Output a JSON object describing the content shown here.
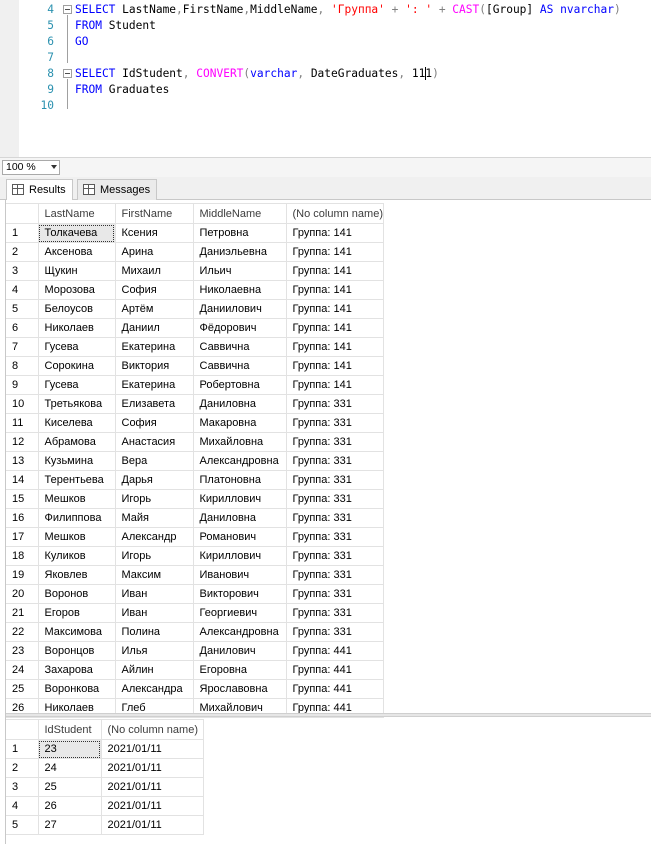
{
  "editor": {
    "lines": [
      {
        "number": "4",
        "tokens": [
          {
            "t": "SELECT",
            "c": "kw"
          },
          {
            "t": " LastName",
            "c": "id"
          },
          {
            "t": ",",
            "c": "op"
          },
          {
            "t": "FirstName",
            "c": "id"
          },
          {
            "t": ",",
            "c": "op"
          },
          {
            "t": "MiddleName",
            "c": "id"
          },
          {
            "t": ", ",
            "c": "op"
          },
          {
            "t": "'Группа'",
            "c": "str"
          },
          {
            "t": " + ",
            "c": "op"
          },
          {
            "t": "': '",
            "c": "str"
          },
          {
            "t": " + ",
            "c": "op"
          },
          {
            "t": "CAST",
            "c": "fn"
          },
          {
            "t": "(",
            "c": "op"
          },
          {
            "t": "[Group]",
            "c": "id"
          },
          {
            "t": " AS ",
            "c": "kw"
          },
          {
            "t": "nvarchar",
            "c": "ty"
          },
          {
            "t": ")",
            "c": "op"
          }
        ]
      },
      {
        "number": "5",
        "tokens": [
          {
            "t": "FROM",
            "c": "kw"
          },
          {
            "t": " Student",
            "c": "id"
          }
        ]
      },
      {
        "number": "6",
        "tokens": [
          {
            "t": "GO",
            "c": "kw"
          }
        ]
      },
      {
        "number": "7",
        "tokens": []
      },
      {
        "number": "8",
        "tokens": [
          {
            "t": "SELECT",
            "c": "kw"
          },
          {
            "t": " IdStudent",
            "c": "id"
          },
          {
            "t": ", ",
            "c": "op"
          },
          {
            "t": "CONVERT",
            "c": "fn"
          },
          {
            "t": "(",
            "c": "op"
          },
          {
            "t": "varchar",
            "c": "ty"
          },
          {
            "t": ", ",
            "c": "op"
          },
          {
            "t": "DateGraduates",
            "c": "id"
          },
          {
            "t": ", ",
            "c": "op"
          },
          {
            "t": "111",
            "c": "id"
          },
          {
            "t": ")",
            "c": "op"
          }
        ]
      },
      {
        "number": "9",
        "tokens": [
          {
            "t": "FROM",
            "c": "kw"
          },
          {
            "t": " Graduates",
            "c": "id"
          }
        ]
      },
      {
        "number": "10",
        "tokens": []
      }
    ]
  },
  "zoom": {
    "value": "100 %"
  },
  "tabs": [
    {
      "label": "Results",
      "active": true
    },
    {
      "label": "Messages",
      "active": false
    }
  ],
  "grid1": {
    "columns": [
      "",
      "LastName",
      "FirstName",
      "MiddleName",
      "(No column name)"
    ],
    "rows": [
      [
        "1",
        "Толкачева",
        "Ксения",
        "Петровна",
        "Группа: 141"
      ],
      [
        "2",
        "Аксенова",
        "Арина",
        "Даниэльевна",
        "Группа: 141"
      ],
      [
        "3",
        "Щукин",
        "Михаил",
        "Ильич",
        "Группа: 141"
      ],
      [
        "4",
        "Морозова",
        "София",
        "Николаевна",
        "Группа: 141"
      ],
      [
        "5",
        "Белоусов",
        "Артём",
        "Даниилович",
        "Группа: 141"
      ],
      [
        "6",
        "Николаев",
        "Даниил",
        "Фёдорович",
        "Группа: 141"
      ],
      [
        "7",
        "Гусева",
        "Екатерина",
        "Саввична",
        "Группа: 141"
      ],
      [
        "8",
        "Сорокина",
        "Виктория",
        "Саввична",
        "Группа: 141"
      ],
      [
        "9",
        "Гусева",
        "Екатерина",
        "Робертовна",
        "Группа: 141"
      ],
      [
        "10",
        "Третьякова",
        "Елизавета",
        "Даниловна",
        "Группа: 331"
      ],
      [
        "11",
        "Киселева",
        "София",
        "Макаровна",
        "Группа: 331"
      ],
      [
        "12",
        "Абрамова",
        "Анастасия",
        "Михайловна",
        "Группа: 331"
      ],
      [
        "13",
        "Кузьмина",
        "Вера",
        "Александровна",
        "Группа: 331"
      ],
      [
        "14",
        "Терентьева",
        "Дарья",
        "Платоновна",
        "Группа: 331"
      ],
      [
        "15",
        "Мешков",
        "Игорь",
        "Кириллович",
        "Группа: 331"
      ],
      [
        "16",
        "Филиппова",
        "Майя",
        "Даниловна",
        "Группа: 331"
      ],
      [
        "17",
        "Мешков",
        "Александр",
        "Романович",
        "Группа: 331"
      ],
      [
        "18",
        "Куликов",
        "Игорь",
        "Кириллович",
        "Группа: 331"
      ],
      [
        "19",
        "Яковлев",
        "Максим",
        "Иванович",
        "Группа: 331"
      ],
      [
        "20",
        "Воронов",
        "Иван",
        "Викторович",
        "Группа: 331"
      ],
      [
        "21",
        "Егоров",
        "Иван",
        "Георгиевич",
        "Группа: 331"
      ],
      [
        "22",
        "Максимова",
        "Полина",
        "Александровна",
        "Группа: 331"
      ],
      [
        "23",
        "Воронцов",
        "Илья",
        "Данилович",
        "Группа: 441"
      ],
      [
        "24",
        "Захарова",
        "Айлин",
        "Егоровна",
        "Группа: 441"
      ],
      [
        "25",
        "Воронкова",
        "Александра",
        "Ярославовна",
        "Группа: 441"
      ],
      [
        "26",
        "Николаев",
        "Глеб",
        "Михайлович",
        "Группа: 441"
      ]
    ]
  },
  "grid2": {
    "columns": [
      "",
      "IdStudent",
      "(No column name)"
    ],
    "rows": [
      [
        "1",
        "23",
        "2021/01/11"
      ],
      [
        "2",
        "24",
        "2021/01/11"
      ],
      [
        "3",
        "25",
        "2021/01/11"
      ],
      [
        "4",
        "26",
        "2021/01/11"
      ],
      [
        "5",
        "27",
        "2021/01/11"
      ]
    ]
  }
}
